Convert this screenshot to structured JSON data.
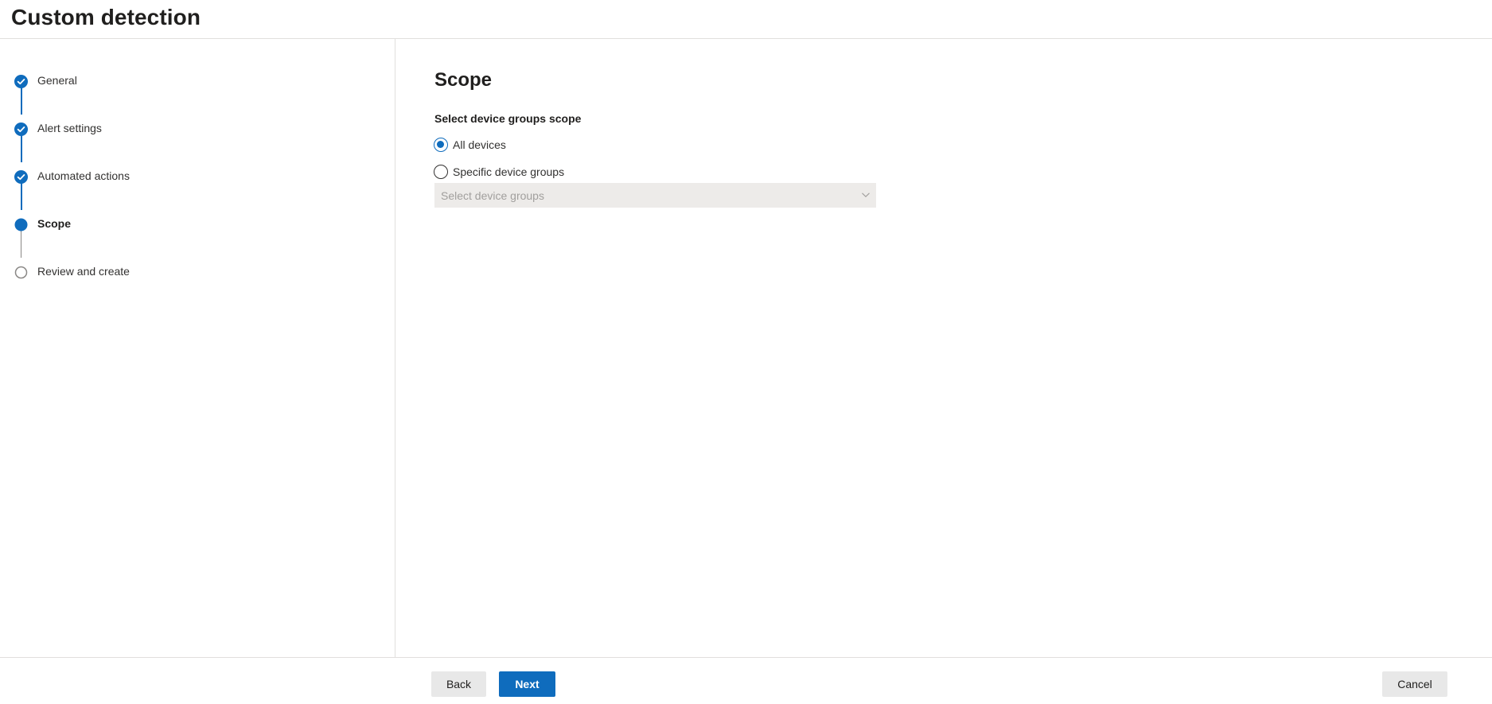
{
  "page": {
    "title": "Custom detection"
  },
  "wizard": {
    "steps": [
      {
        "label": "General",
        "status": "completed"
      },
      {
        "label": "Alert settings",
        "status": "completed"
      },
      {
        "label": "Automated actions",
        "status": "completed"
      },
      {
        "label": "Scope",
        "status": "current"
      },
      {
        "label": "Review and create",
        "status": "pending"
      }
    ]
  },
  "scope": {
    "title": "Scope",
    "field_label": "Select device groups scope",
    "options": [
      {
        "label": "All devices",
        "selected": true
      },
      {
        "label": "Specific device groups",
        "selected": false
      }
    ],
    "dropdown": {
      "placeholder": "Select device groups",
      "disabled": true
    }
  },
  "footer": {
    "back_label": "Back",
    "next_label": "Next",
    "cancel_label": "Cancel"
  },
  "colors": {
    "accent": "#0f6cbd",
    "border": "#e1dfdd",
    "disabled_bg": "#edebe9",
    "secondary_button": "#e8e8e8"
  }
}
